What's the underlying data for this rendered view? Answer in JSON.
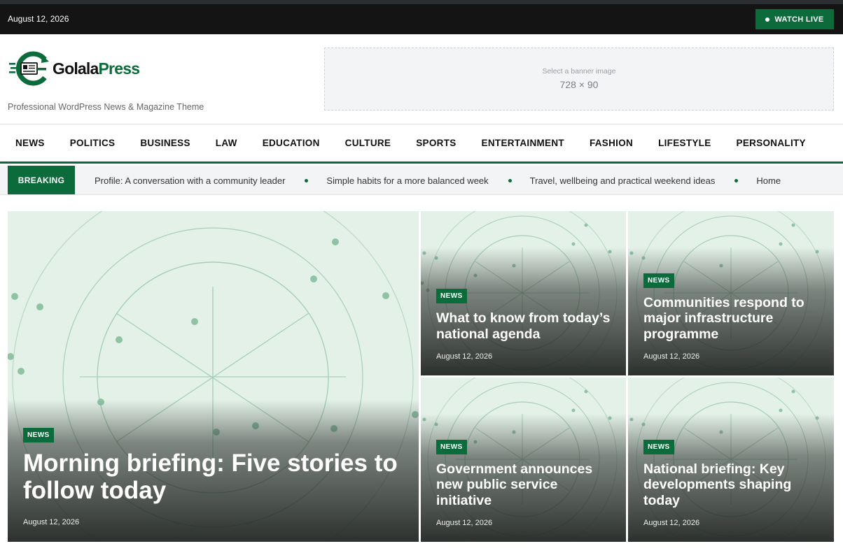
{
  "topbar": {
    "date": "August 12, 2026",
    "watch_live": "WATCH LIVE"
  },
  "header": {
    "logo_prefix": "Golala",
    "logo_suffix": "Press",
    "tagline": "Professional WordPress News & Magazine Theme",
    "banner_hint": "Select a banner image",
    "banner_size": "728 × 90"
  },
  "nav": {
    "items": [
      "NEWS",
      "POLITICS",
      "BUSINESS",
      "LAW",
      "EDUCATION",
      "CULTURE",
      "SPORTS",
      "ENTERTAINMENT",
      "FASHION",
      "LIFESTYLE",
      "PERSONALITY"
    ]
  },
  "ticker": {
    "label": "BREAKING",
    "items": [
      "Profile: A conversation with a community leader",
      "Simple habits for a more balanced week",
      "Travel, wellbeing and practical weekend ideas",
      "Home"
    ]
  },
  "featured": {
    "tag": "NEWS",
    "title": "Morning briefing: Five stories to follow today",
    "date": "August 12, 2026"
  },
  "cards": [
    {
      "tag": "NEWS",
      "title": "What to know from today’s national agenda",
      "date": "August 12, 2026"
    },
    {
      "tag": "NEWS",
      "title": "Communities respond to major infrastructure programme",
      "date": "August 12, 2026"
    },
    {
      "tag": "NEWS",
      "title": "Government announces new public service initiative",
      "date": "August 12, 2026"
    },
    {
      "tag": "NEWS",
      "title": "National briefing: Key developments shaping today",
      "date": "August 12, 2026"
    }
  ],
  "colors": {
    "brand": "#0c6b3a",
    "topbar": "#141414",
    "ticker_bg": "#f3f4f5"
  }
}
